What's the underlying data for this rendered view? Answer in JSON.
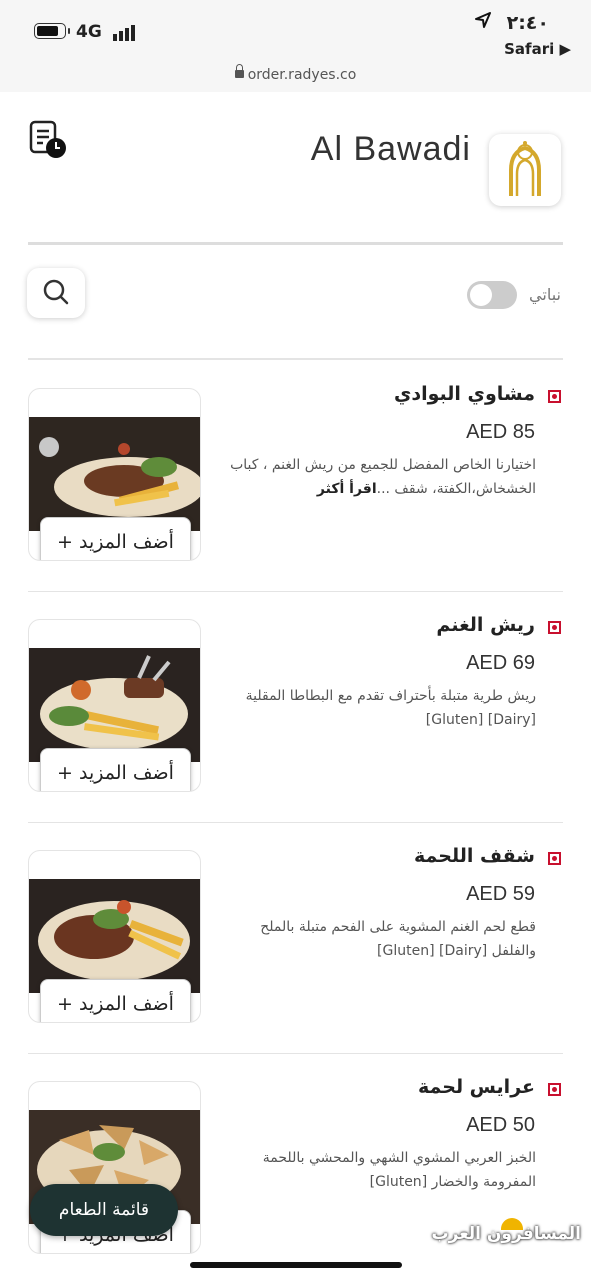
{
  "status_bar": {
    "network": "4G",
    "time": "٢:٤٠",
    "back_app": "Safari ▶"
  },
  "browser": {
    "url": "order.radyes.co"
  },
  "header": {
    "restaurant_name": "Al Bawadi",
    "veg_label": "نباتي",
    "veg_toggle_on": false
  },
  "menu_items": [
    {
      "name": "مشاوي البوادي",
      "price": "AED 85",
      "description": "اختيارنا الخاص المفضل للجميع من ريش الغنم ، كباب الخشخاش،الكفتة، شقف ...",
      "more": "اقرأ أكثر",
      "add_label": "أضف المزيد +"
    },
    {
      "name": "ريش الغنم",
      "price": "AED 69",
      "description": "ريش طرية متبلة بأحتراف تقدم مع البطاطا المقلية [Dairy] [Gluten]",
      "add_label": "أضف المزيد +"
    },
    {
      "name": "شقف اللحمة",
      "price": "AED 59",
      "description": "قطع لحم الغنم المشوية على الفحم متبلة بالملح والفلفل [Dairy] [Gluten]",
      "add_label": "أضف المزيد +"
    },
    {
      "name": "عرايس لحمة",
      "price": "AED 50",
      "description": "الخبز العربي المشوي الشهي والمحشي باللحمة المفرومة والخضار [Gluten]",
      "add_label": "أضف المزيد +"
    }
  ],
  "menu_button": "قائمة الطعام",
  "watermark": "المسافرون العرب",
  "colors": {
    "accent": "#c8102e",
    "fab": "#1e3332",
    "logo_gold": "#d4a82c"
  }
}
